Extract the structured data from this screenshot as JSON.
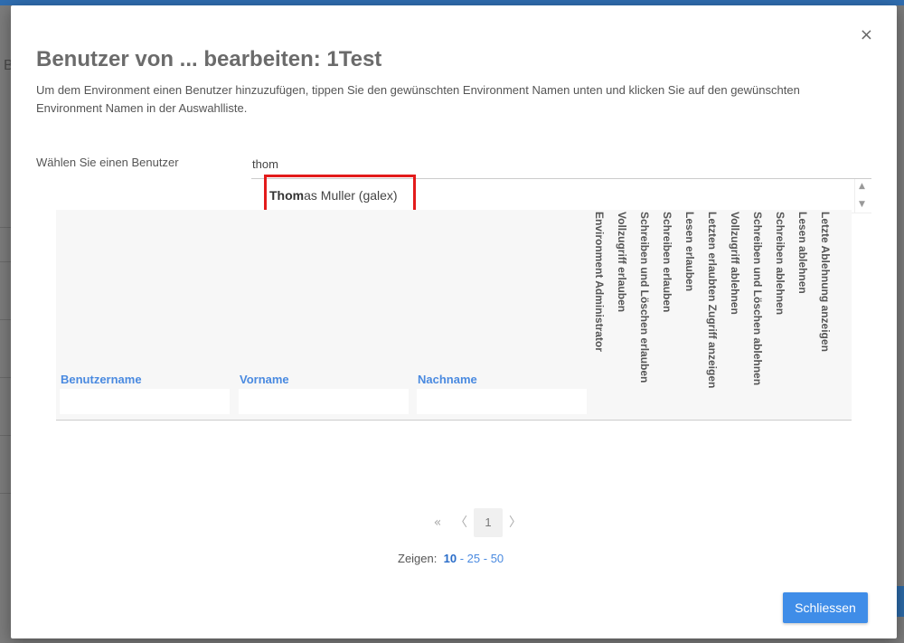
{
  "background": {
    "partial_letter": "B"
  },
  "modal": {
    "close_glyph": "×",
    "title": "Benutzer von ... bearbeiten: 1Test",
    "description": "Um dem Environment einen Benutzer hinzuzufügen, tippen Sie den gewünschten Environment Namen unten und klicken Sie auf den gewünschten Environment Namen in der Auswahlliste.",
    "field_label": "Wählen Sie einen Benutzer",
    "input_value": "thom",
    "suggestion": {
      "match": "Thom",
      "rest": "as Muller (galex)"
    }
  },
  "table": {
    "columns": [
      "Benutzername",
      "Vorname",
      "Nachname"
    ],
    "permission_columns": [
      "Environment Administrator",
      "Vollzugriff erlauben",
      "Schreiben und Löschen erlauben",
      "Schreiben erlauben",
      "Lesen erlauben",
      "Letzten erlaubten Zugriff anzeigen",
      "Vollzugriff ablehnen",
      "Schreiben und Löschen ablehnen",
      "Schreiben ablehnen",
      "Lesen ablehnen",
      "Letzte Ablehnung anzeigen"
    ]
  },
  "pagination": {
    "first": "«",
    "prev": "〈",
    "current_page": "1",
    "next": "〉",
    "show_label": "Zeigen:",
    "page_sizes": [
      "10",
      "25",
      "50"
    ],
    "selected_size": "10"
  },
  "footer": {
    "close_button": "Schliessen"
  },
  "colors": {
    "accent": "#3f8de8",
    "link": "#4a8ae0",
    "highlight": "#e31b1b"
  }
}
